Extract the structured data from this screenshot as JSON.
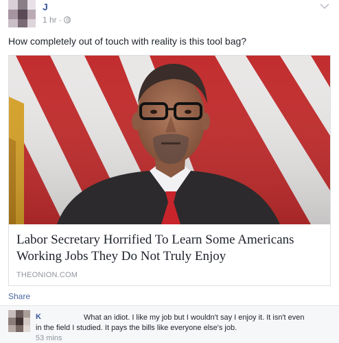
{
  "post": {
    "author": "J",
    "time": "1 hr",
    "separator": "·",
    "audience_icon": "globe-icon",
    "menu_icon": "chevron-down-icon",
    "message": "How completely out of touch with reality is this tool bag?"
  },
  "link_card": {
    "title": "Labor Secretary Horrified To Learn Some Americans Working Jobs They Do Not Truly Enjoy",
    "domain": "THEONION.COM"
  },
  "actions": {
    "share_label": "Share"
  },
  "comment": {
    "author": "K",
    "text": "What an idiot. I like my job but I wouldn't say I enjoy it. It isn't even in the field I studied. It pays the bills like everyone else's job.",
    "time": "53 mins"
  },
  "colors": {
    "link_blue": "#365899",
    "meta_gray": "#90949c",
    "text": "#1d2129",
    "flag_red": "#c22d2e",
    "suit": "#2c2a2c"
  }
}
